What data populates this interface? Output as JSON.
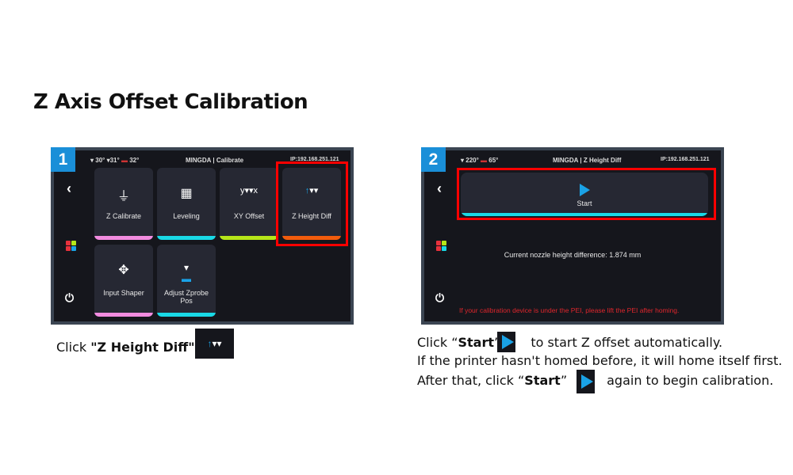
{
  "title": "Z Axis Offset Calibration",
  "step1": {
    "badge": "1",
    "temps": [
      "30°",
      "31°",
      "32°"
    ],
    "header": "MINGDA | Calibrate",
    "ip": "IP:192.168.251.121",
    "tiles": [
      {
        "label": "Z Calibrate",
        "color": "#f28ce0"
      },
      {
        "label": "Leveling",
        "color": "#19d9e6"
      },
      {
        "label": "XY Offset",
        "color": "#b6e619"
      },
      {
        "label": "Z Height Diff",
        "color": "#f25c0c"
      },
      {
        "label": "Input Shaper",
        "color": "#f28ce0"
      },
      {
        "label": "Adjust Zprobe Pos",
        "color": "#19d9e6"
      }
    ],
    "caption_prefix": "Click ",
    "caption_bold": "\"Z Height Diff\""
  },
  "step2": {
    "badge": "2",
    "temps": [
      "220°",
      "65°"
    ],
    "header": "MINGDA  | Z Height Diff",
    "ip": "IP:192.168.251.121",
    "start_label": "Start",
    "height_diff": "Current nozzle height difference: 1.874 mm",
    "warning": "If your calibration device is under the PEI, please lift the PEI after homing.",
    "line1_prefix": "Click “",
    "line1_bold": "Start",
    "line1_close": "”",
    "line1_suffix": "to start Z offset automatically.",
    "line2": "If the printer hasn't homed before, it will home itself first.",
    "line3_prefix": "After that, click  “",
    "line3_bold": "Start",
    "line3_close": "”",
    "line3_suffix": "again to begin calibration."
  },
  "colors": {
    "accent": "#1a8fd8",
    "highlight": "#ff0000",
    "warning": "#e0262c"
  }
}
